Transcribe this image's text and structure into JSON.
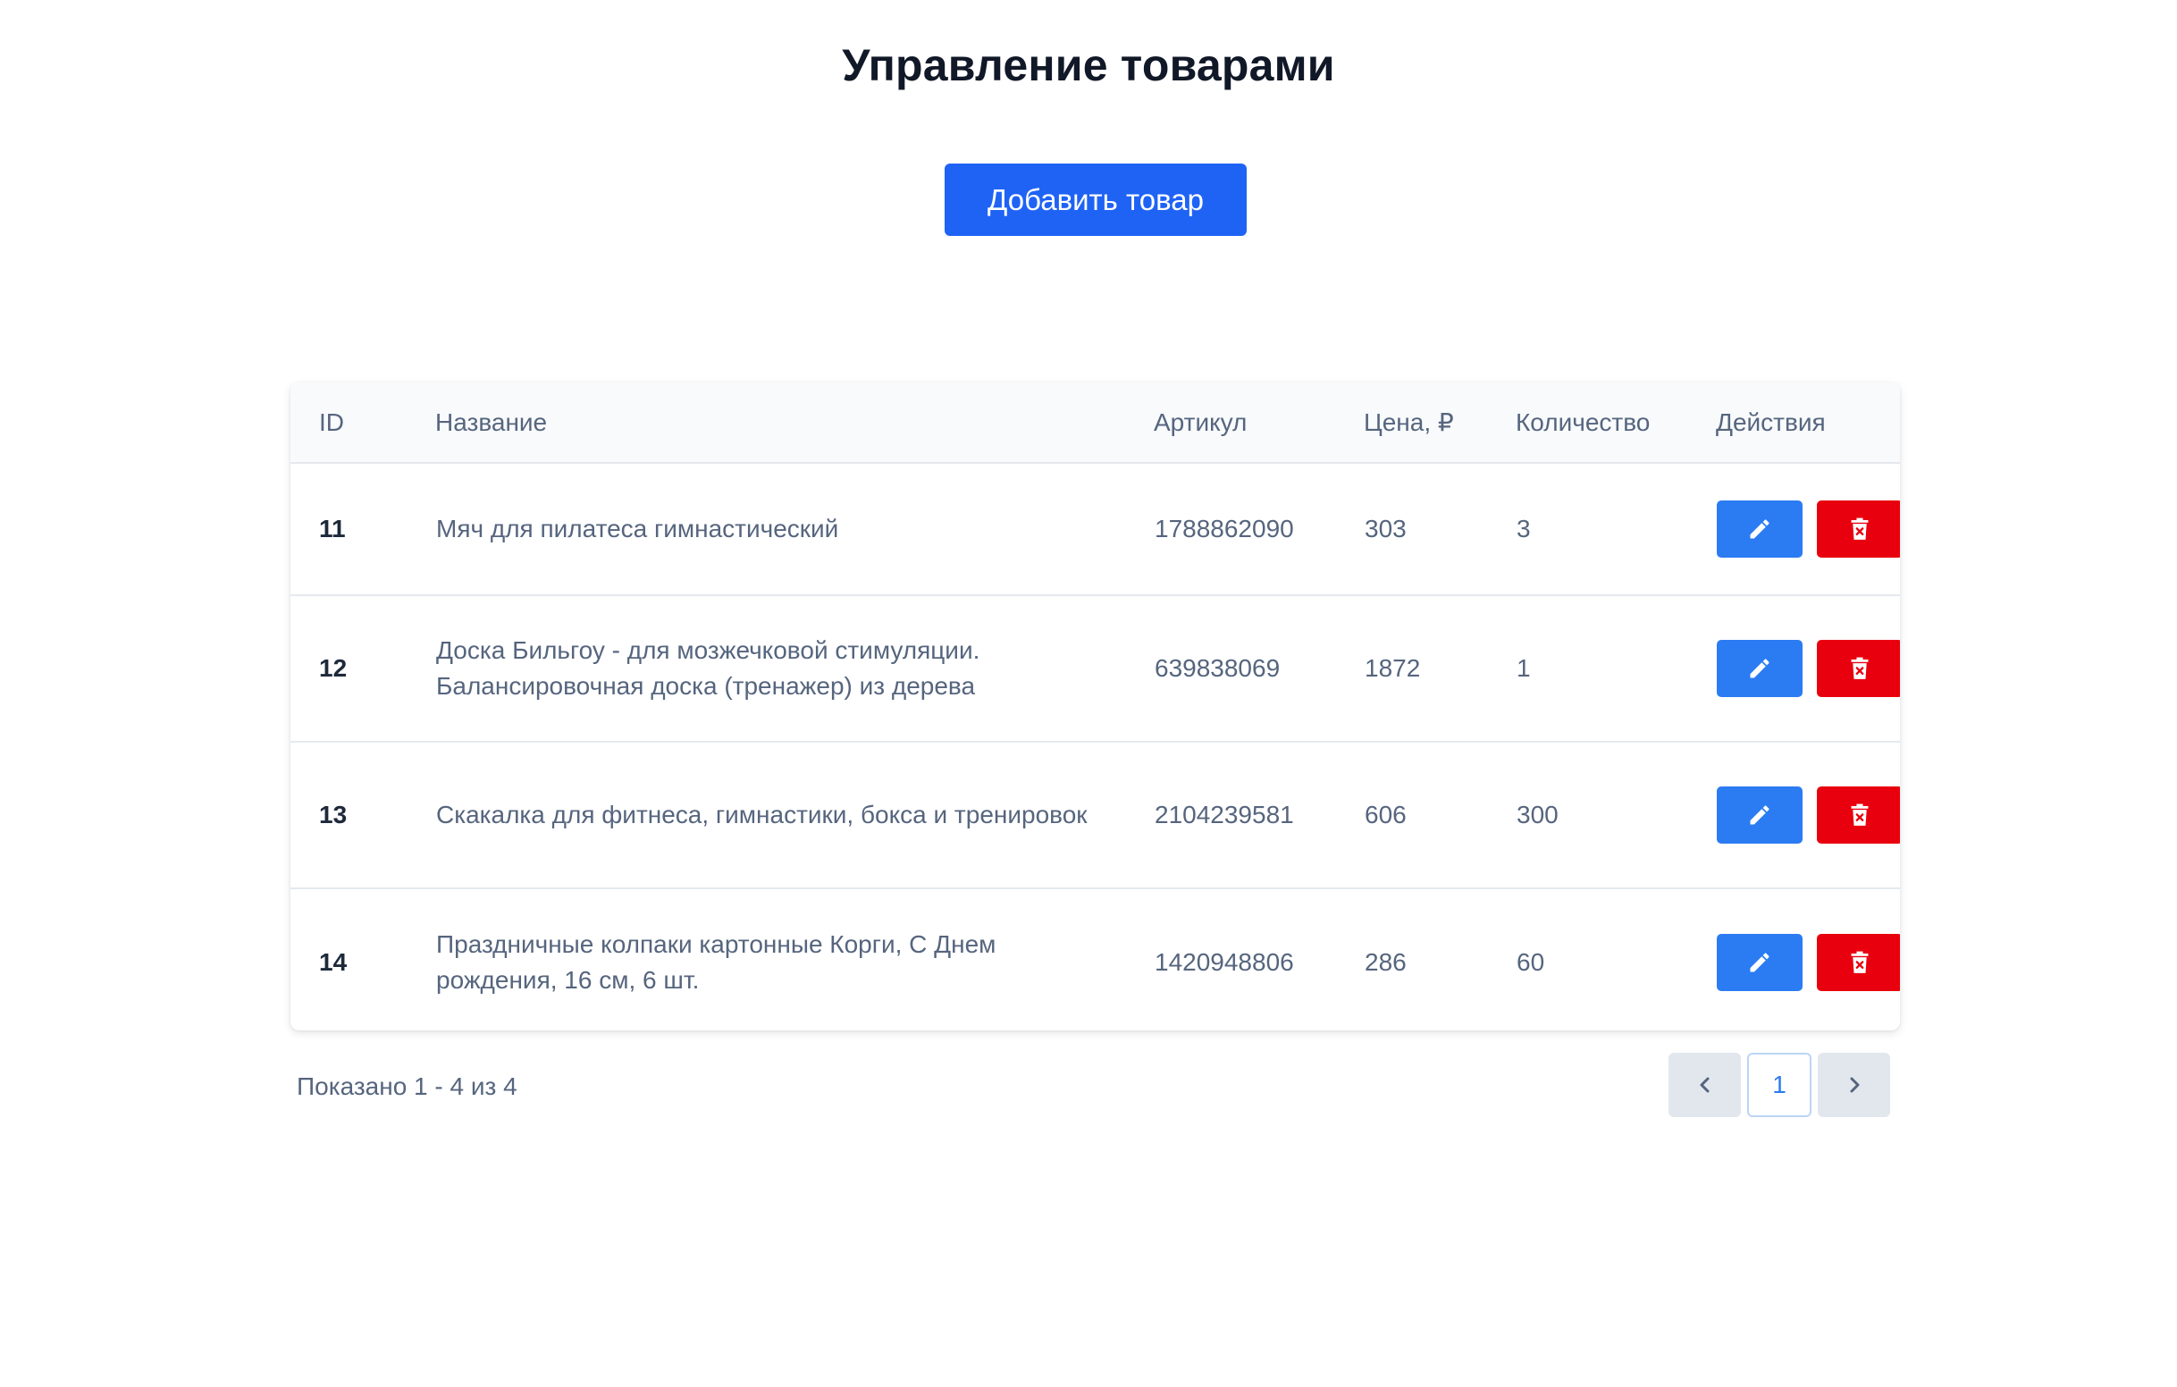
{
  "page": {
    "title": "Управление товарами",
    "add_button_label": "Добавить товар"
  },
  "table": {
    "columns": [
      "ID",
      "Название",
      "Артикул",
      "Цена, ₽",
      "Количество",
      "Действия"
    ],
    "rows": [
      {
        "id": "11",
        "name": "Мяч для пилатеса гимнастический",
        "sku": "1788862090",
        "price": "303",
        "qty": "3"
      },
      {
        "id": "12",
        "name": "Доска Бильгоу - для мозжечковой стимуляции. Балансировочная доска (тренажер) из дерева",
        "sku": "639838069",
        "price": "1872",
        "qty": "1"
      },
      {
        "id": "13",
        "name": "Скакалка для фитнеса, гимнастики, бокса и тренировок",
        "sku": "2104239581",
        "price": "606",
        "qty": "300"
      },
      {
        "id": "14",
        "name": "Праздничные колпаки картонные Корги, С Днем рождения, 16 см, 6 шт.",
        "sku": "1420948806",
        "price": "286",
        "qty": "60"
      }
    ],
    "row_actions": [
      {
        "name": "edit",
        "icon": "pencil-icon",
        "color": "#2b7cf2"
      },
      {
        "name": "delete",
        "icon": "trash-icon",
        "color": "#e8000e"
      }
    ]
  },
  "footer": {
    "summary": "Показано 1 - 4 из 4"
  },
  "pagination": {
    "prev_icon": "chevron-left-icon",
    "current_page": "1",
    "next_icon": "chevron-right-icon"
  },
  "colors": {
    "primary": "#1f63f5",
    "edit": "#2b7cf2",
    "delete": "#e8000e",
    "text_muted": "#56657e",
    "title": "#111827"
  }
}
